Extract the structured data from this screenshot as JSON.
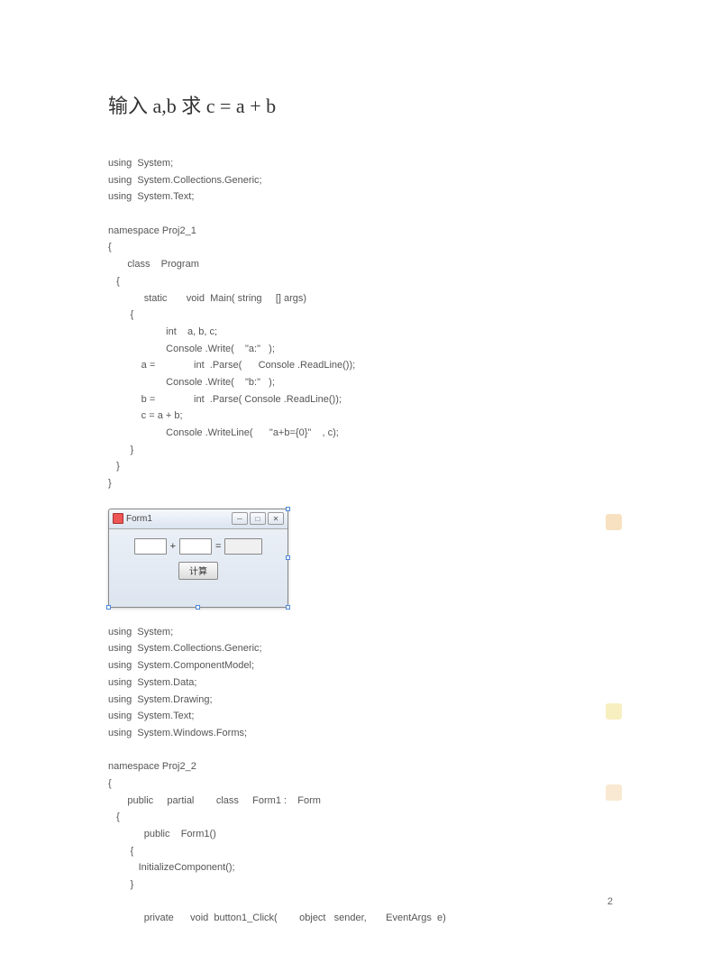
{
  "title": "输入 a,b 求 c = a + b",
  "code1": "using  System;\nusing  System.Collections.Generic;\nusing  System.Text;\n\nnamespace Proj2_1\n{\n       class    Program\n   {\n             static       void  Main( string     [] args)\n        {\n                     int    a, b, c;\n                     Console .Write(    \"a:\"   );\n            a =              int  .Parse(      Console .ReadLine());\n                     Console .Write(    \"b:\"   );\n            b =              int  .Parse( Console .ReadLine());\n            c = a + b;\n                     Console .WriteLine(      \"a+b={0}\"    , c);\n        }\n   }\n}",
  "form": {
    "title": "Form1",
    "plus": "+",
    "equals": "=",
    "button": "计算",
    "min_symbol": "─",
    "max_symbol": "□",
    "close_symbol": "✕"
  },
  "code2": "using  System;\nusing  System.Collections.Generic;\nusing  System.ComponentModel;\nusing  System.Data;\nusing  System.Drawing;\nusing  System.Text;\nusing  System.Windows.Forms;\n\nnamespace Proj2_2\n{\n       public     partial        class     Form1 :    Form\n   {\n             public    Form1()\n        {\n           InitializeComponent();\n        }\n\n             private      void  button1_Click(        object   sender,       EventArgs  e)",
  "page_number": "2"
}
